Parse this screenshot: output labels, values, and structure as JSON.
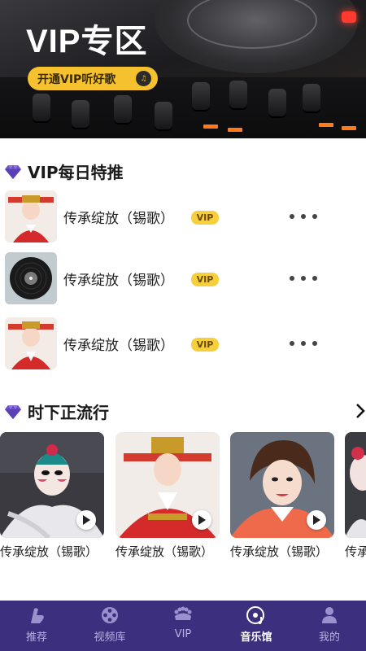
{
  "banner": {
    "title": "VIP专区",
    "cta_label": "开通VIP听好歌",
    "cta_icon_text": "♫"
  },
  "sections": {
    "vip_daily": {
      "title": "VIP每日特推",
      "icon": "diamond-icon"
    },
    "trending": {
      "title": "时下正流行",
      "icon": "diamond-icon",
      "more_icon": "chevron-right-icon"
    }
  },
  "vip_songs": [
    {
      "title": "传承绽放（锡歌）",
      "badge": "VIP",
      "thumb": "opera-portrait"
    },
    {
      "title": "传承绽放（锡歌）",
      "badge": "VIP",
      "thumb": "vinyl-record"
    },
    {
      "title": "传承绽放（锡歌）",
      "badge": "VIP",
      "thumb": "opera-portrait"
    }
  ],
  "trending_cards": [
    {
      "title": "传承绽放（锡歌）",
      "thumb": "opera-painted-face"
    },
    {
      "title": "传承绽放（锡歌）",
      "thumb": "opera-red-robe"
    },
    {
      "title": "传承绽放（锡歌）",
      "thumb": "singer-portrait"
    },
    {
      "title": "传承",
      "thumb": "opera-partial"
    }
  ],
  "tabbar": {
    "items": [
      {
        "label": "推荐",
        "icon": "recommend-icon",
        "active": false
      },
      {
        "label": "视频库",
        "icon": "film-reel-icon",
        "active": false
      },
      {
        "label": "VIP",
        "icon": "crown-icon",
        "active": false
      },
      {
        "label": "音乐馆",
        "icon": "music-disc-icon",
        "active": true
      },
      {
        "label": "我的",
        "icon": "profile-icon",
        "active": false
      }
    ]
  },
  "colors": {
    "accent": "#f6c12f",
    "tabbar_bg": "#3b2f7e",
    "diamond": "#6b4fc9"
  }
}
